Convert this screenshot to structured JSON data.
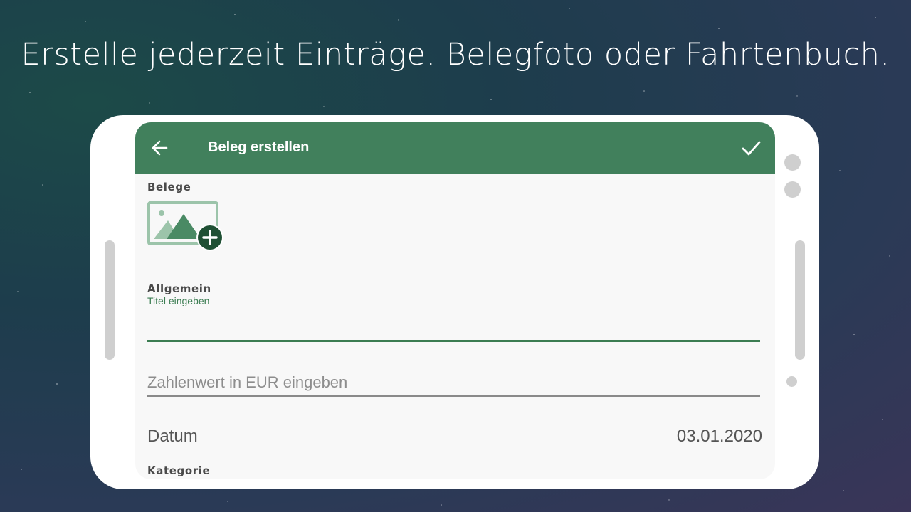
{
  "headline": "Erstelle jederzeit Einträge. Belegfoto oder Fahrtenbuch.",
  "appbar": {
    "title": "Beleg erstellen",
    "back_icon": "arrow-left-icon",
    "confirm_icon": "check-icon",
    "color": "#41805c"
  },
  "sections": {
    "belege": "Belege",
    "allgemein": "Allgemein",
    "kategorie": "Kategorie"
  },
  "add_photo_icon": "add-photo-icon",
  "form": {
    "title_label": "Titel eingeben",
    "title_value": "",
    "amount_placeholder": "Zahlenwert in EUR eingeben",
    "date_label": "Datum",
    "date_value": "03.01.2020"
  },
  "accent_color": "#3c7d52"
}
